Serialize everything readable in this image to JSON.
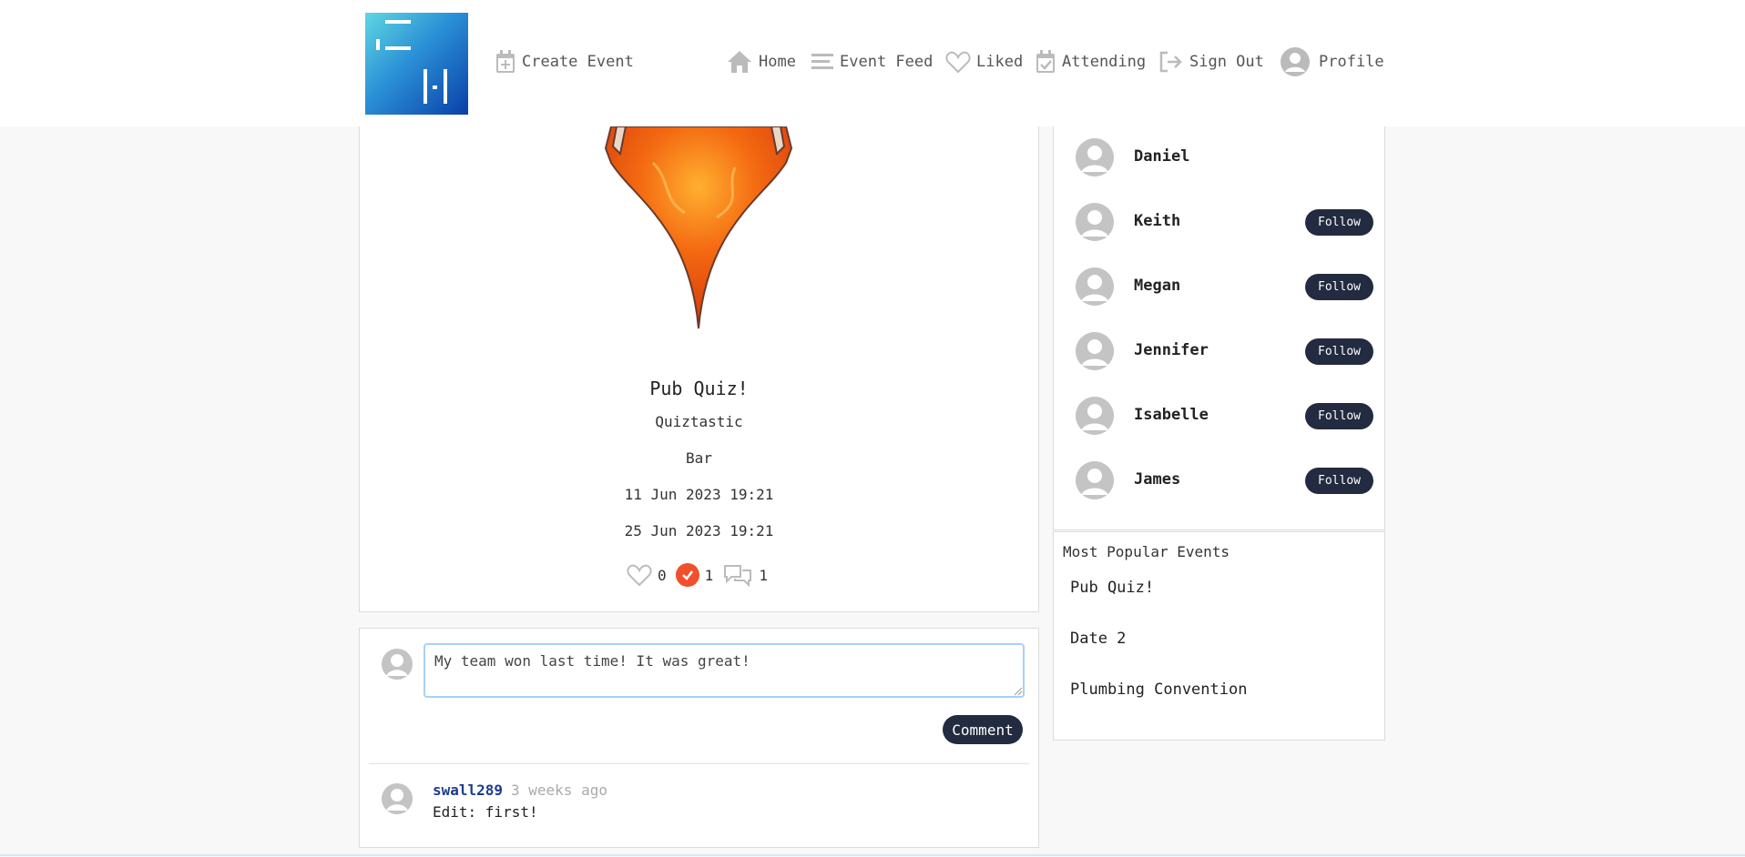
{
  "nav": {
    "create_event": "Create Event",
    "home": "Home",
    "event_feed": "Event Feed",
    "liked": "Liked",
    "attending": "Attending",
    "sign_out": "Sign Out",
    "profile": "Profile"
  },
  "event": {
    "title": "Pub Quiz!",
    "host": "Quiztastic",
    "venue": "Bar",
    "start": "11 Jun 2023 19:21",
    "end": "25 Jun 2023 19:21",
    "likes": "0",
    "attending": "1",
    "comments": "1"
  },
  "comment_form": {
    "value": "My team won last time! It was great!",
    "button": "Comment"
  },
  "comments": [
    {
      "user": "swall289",
      "time": "3 weeks ago",
      "text": "Edit: first!"
    }
  ],
  "users": [
    {
      "name": "Daniel",
      "follow": ""
    },
    {
      "name": "Keith",
      "follow": "Follow"
    },
    {
      "name": "Megan",
      "follow": "Follow"
    },
    {
      "name": "Jennifer",
      "follow": "Follow"
    },
    {
      "name": "Isabelle",
      "follow": "Follow"
    },
    {
      "name": "James",
      "follow": "Follow"
    }
  ],
  "popular": {
    "heading": "Most Popular Events",
    "items": [
      "Pub Quiz!",
      "Date 2",
      "Plumbing Convention"
    ]
  },
  "colors": {
    "dark_button": "#222b3f",
    "attend_check": "#f0502c",
    "username": "#1c3d8c"
  }
}
